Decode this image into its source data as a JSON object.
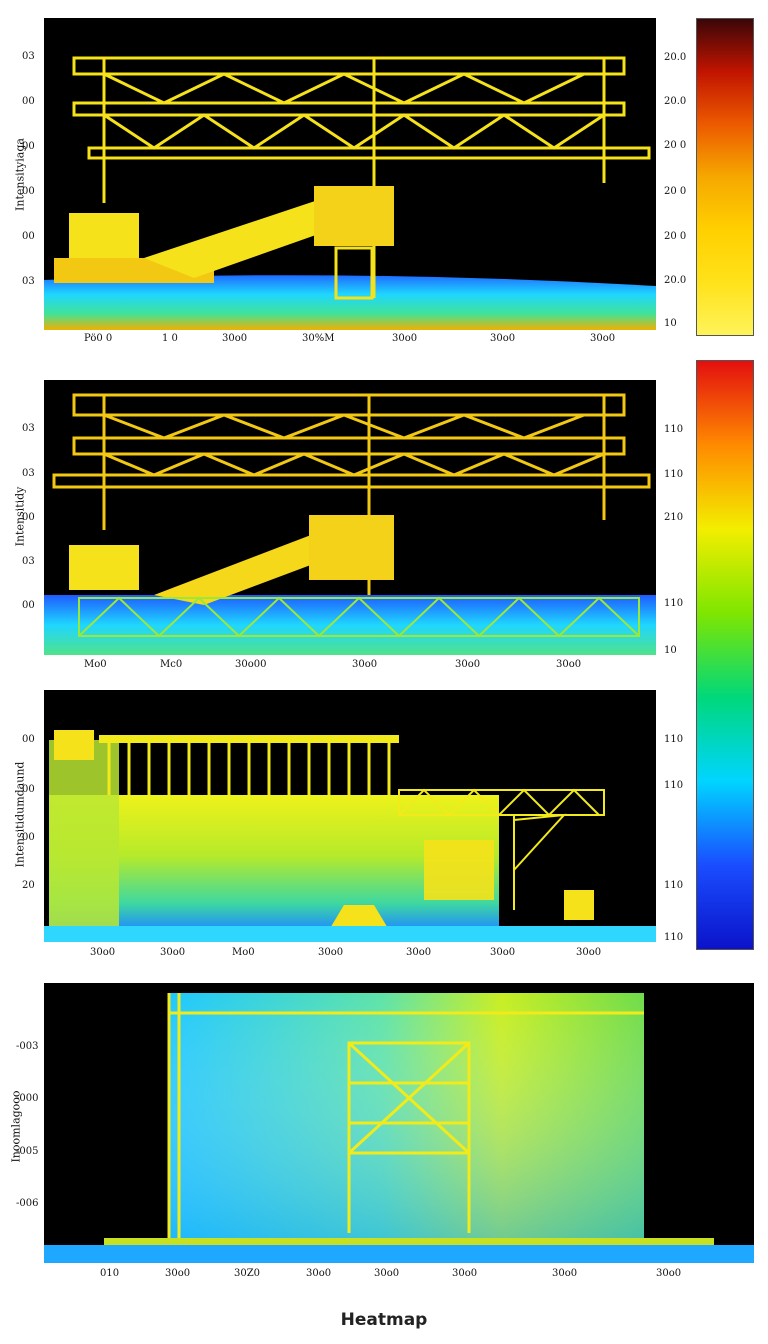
{
  "title": "Heatmap",
  "colors": {
    "hot": [
      "#fff35a",
      "#ffe21a",
      "#ffd000",
      "#f6a800",
      "#ec5a00",
      "#c11400",
      "#3b0608"
    ],
    "jet": [
      "#e30f0f",
      "#ff8a00",
      "#f3ee00",
      "#7fe600",
      "#00d87a",
      "#00d5ff",
      "#1a4dff",
      "#0b13c9"
    ],
    "structure": "#f2ea1a",
    "ground": "#22b8f0"
  },
  "chart_data": [
    {
      "type": "heatmap",
      "ylabel": "Intensityiaga",
      "yticks": [
        "03",
        "00",
        "00",
        "00",
        "00",
        "03"
      ],
      "xticks": [
        "Pö0 0",
        "1 0",
        "30o0",
        "30%M",
        "30o0",
        "30o0",
        "30o0"
      ],
      "colorbar": {
        "colormap": "hot",
        "ticks": [
          "20.0",
          "20.0",
          "20 0",
          "20 0",
          "20 0",
          "20.0",
          "10"
        ]
      }
    },
    {
      "type": "heatmap",
      "ylabel": "Intensitidy",
      "yticks": [
        "03",
        "03",
        "00",
        "03",
        "00"
      ],
      "xticks": [
        "Mo0",
        "Mc0",
        "30o00",
        "30o0",
        "30o0",
        "30o0"
      ],
      "colorbar": {
        "colormap": "jet",
        "ticks": [
          "110",
          "110",
          "210",
          "110",
          "10",
          "110",
          "110",
          "110",
          "110"
        ]
      }
    },
    {
      "type": "heatmap",
      "ylabel": "Intensitidumdaund",
      "yticks": [
        "00",
        "00",
        "00",
        "20"
      ],
      "xticks": [
        "30o0",
        "30o0",
        "Mo0",
        "30o0",
        "30o0",
        "30o0",
        "30o0"
      ]
    },
    {
      "type": "heatmap",
      "ylabel": "Inoomlagooo",
      "yticks": [
        "-003",
        "-000",
        "-005",
        "-006"
      ],
      "xticks": [
        "010",
        "30o0",
        "30Z0",
        "30o0",
        "30o0",
        "30o0",
        "30o0",
        "30o0"
      ]
    }
  ]
}
